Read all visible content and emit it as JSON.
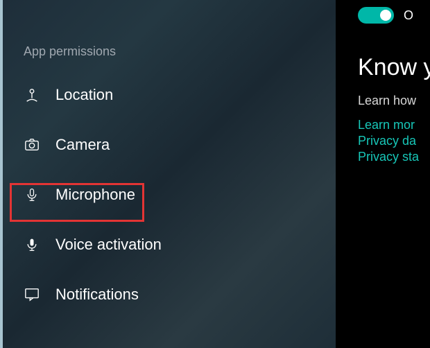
{
  "sidebar": {
    "section": "App permissions",
    "items": [
      {
        "label": "Location"
      },
      {
        "label": "Camera"
      },
      {
        "label": "Microphone"
      },
      {
        "label": "Voice activation"
      },
      {
        "label": "Notifications"
      }
    ]
  },
  "right": {
    "toggle": "O",
    "title": "Know yo",
    "subtitle": "Learn how",
    "links": [
      "Learn mor",
      "Privacy da",
      "Privacy sta"
    ]
  }
}
